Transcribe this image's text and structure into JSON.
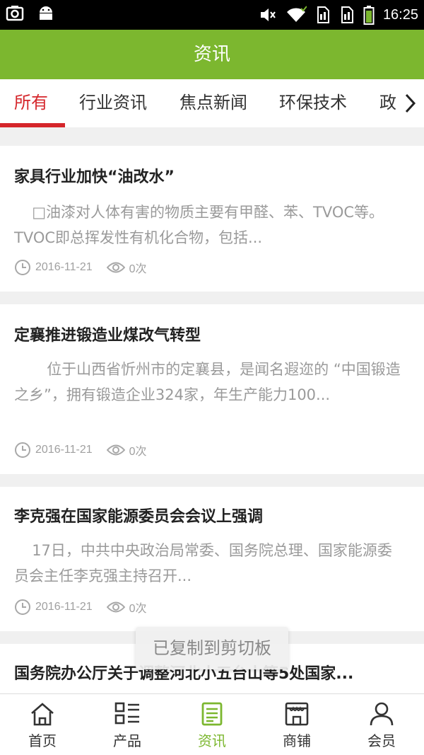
{
  "status_bar": {
    "time": "16:25"
  },
  "header": {
    "title": "资讯"
  },
  "tabs": [
    "所有",
    "行业资讯",
    "焦点新闻",
    "环保技术",
    "政策"
  ],
  "articles": [
    {
      "title": "家具行业加快“油改水”",
      "summary": "□油漆对人体有害的物质主要有甲醛、苯、TVOC等。TVOC即总挥发性有机化合物，包括...",
      "date": "2016-11-21",
      "views": "0次"
    },
    {
      "title": "定襄推进锻造业煤改气转型",
      "summary": "位于山西省忻州市的定襄县，是闻名遐迩的 “中国锻造之乡”，拥有锻造企业324家，年生产能力100...",
      "date": "2016-11-21",
      "views": "0次"
    },
    {
      "title": "李克强在国家能源委员会会议上强调",
      "summary": "17日，中共中央政治局常委、国务院总理、国家能源委员会主任李克强主持召开...",
      "date": "2016-11-21",
      "views": "0次"
    },
    {
      "title": "国务院办公厅关于调整河北小五台山等5处国家...",
      "summary": "",
      "date": "",
      "views": ""
    }
  ],
  "toast": "已复制到剪切板",
  "bottom_nav": [
    {
      "label": "首页",
      "icon": "home-icon"
    },
    {
      "label": "产品",
      "icon": "grid-list-icon"
    },
    {
      "label": "资讯",
      "icon": "news-icon"
    },
    {
      "label": "商铺",
      "icon": "shop-icon"
    },
    {
      "label": "会员",
      "icon": "user-icon"
    }
  ],
  "colors": {
    "brand_green": "#7cb72f",
    "active_red": "#d5262b"
  }
}
